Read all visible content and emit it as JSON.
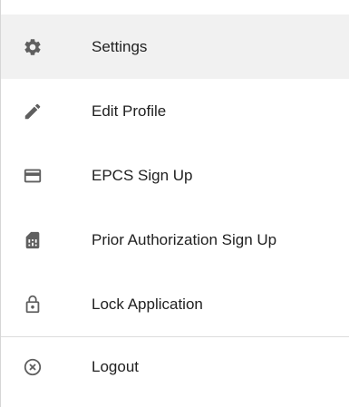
{
  "menu": {
    "items": [
      {
        "label": "Settings",
        "icon": "gear-icon",
        "active": true
      },
      {
        "label": "Edit Profile",
        "icon": "pencil-icon",
        "active": false
      },
      {
        "label": "EPCS Sign Up",
        "icon": "credit-card-icon",
        "active": false
      },
      {
        "label": "Prior Authorization Sign Up",
        "icon": "sim-card-icon",
        "active": false
      },
      {
        "label": "Lock Application",
        "icon": "lock-icon",
        "active": false
      }
    ],
    "logout": {
      "label": "Logout",
      "icon": "close-circle-icon"
    }
  },
  "colors": {
    "text": "#212121",
    "icon": "#5f5f5f",
    "active_background": "#f1f1f1",
    "divider": "#dcdcdc"
  }
}
